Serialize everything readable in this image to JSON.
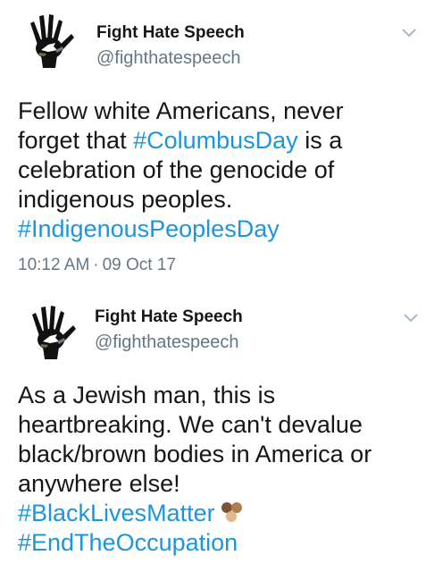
{
  "colors": {
    "text": "#14171a",
    "secondary": "#657786",
    "link": "#1b95e0",
    "background": "#ffffff"
  },
  "tweets": [
    {
      "avatar_icon": "raised-hand-logo-icon",
      "display_name": "Fight Hate Speech",
      "handle": "@fighthatespeech",
      "menu_icon": "chevron-down-icon",
      "lines": [
        [
          {
            "t": "Fellow white Americans, never"
          }
        ],
        [
          {
            "t": "forget that "
          },
          {
            "t": "#ColumbusDay",
            "tag": true
          },
          {
            "t": " is a"
          }
        ],
        [
          {
            "t": "celebration of the genocide of"
          }
        ],
        [
          {
            "t": "indigenous peoples."
          }
        ],
        [
          {
            "t": "#IndigenousPeoplesDay",
            "tag": true
          }
        ]
      ],
      "time": "10:12 AM",
      "separator": "·",
      "date": "09 Oct 17"
    },
    {
      "avatar_icon": "raised-hand-logo-icon",
      "display_name": "Fight Hate Speech",
      "handle": "@fighthatespeech",
      "menu_icon": "chevron-down-icon",
      "lines": [
        [
          {
            "t": "As a Jewish man, this is"
          }
        ],
        [
          {
            "t": "heartbreaking. We can't devalue"
          }
        ],
        [
          {
            "t": "black/brown bodies in America or"
          }
        ],
        [
          {
            "t": "anywhere else!"
          }
        ],
        [
          {
            "t": "#BlackLivesMatter",
            "tag": true,
            "emoji": "three-hands-icon"
          }
        ],
        [
          {
            "t": "#EndTheOccupation",
            "tag": true
          }
        ]
      ]
    }
  ]
}
